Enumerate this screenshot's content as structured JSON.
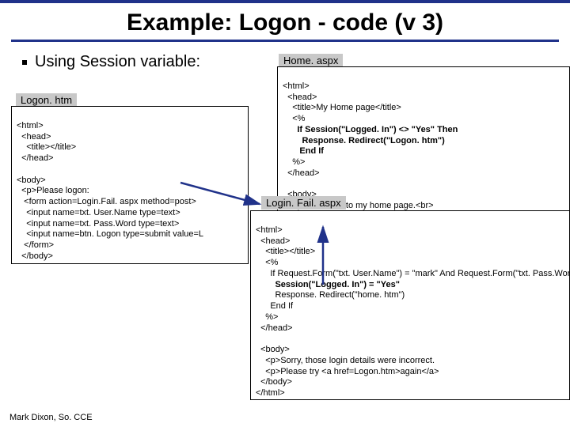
{
  "title": "Example: Logon - code (v 3)",
  "bullet": "Using Session variable:",
  "footer": "Mark Dixon, So. CCE",
  "labels": {
    "logon": "Logon. htm",
    "home": "Home. aspx",
    "fail": "Login. Fail. aspx"
  },
  "code": {
    "logon_head": "<html>\n  <head>\n    <title></title>\n  </head>",
    "logon_body": "<body>\n  <p>Please logon:\n   <form action=Login.Fail. aspx method=post>\n    <input name=txt. User.Name type=text>\n    <input name=txt. Pass.Word type=text>\n    <input name=btn. Logon type=submit value=L\n   </form>\n  </body>\n</html>",
    "home_head_pre": "<html>\n  <head>\n    <title>My Home page</title>\n    <%\n      ",
    "home_head_bold": "If Session(\"Logged. In\") <> \"Yes\" Then\n        Response. Redirect(\"Logon. htm\")\n       End If",
    "home_head_post": "\n    %>\n  </head>",
    "home_body": "  <body>\n    <p>Welcome to my home page.<br>\n      <img src=\"You. Are.Here. jpg\" WIDTH=\"450\" HEIGHT=\"2\n  </body>\n</html>",
    "fail_head_pre": "<html>\n  <head>\n    <title></title>\n    <%\n      If Request.Form(\"txt. User.Name\") = \"mark\" And Request.Form(\"txt. Pass.Word\") =\n        ",
    "fail_head_bold": "Session(\"Logged. In\") = \"Yes\"",
    "fail_head_post": "\n        Response. Redirect(\"home. htm\")\n      End If\n    %>\n  </head>",
    "fail_body": "  <body>\n    <p>Sorry, those login details were incorrect.\n    <p>Please try <a href=Logon.htm>again</a>\n  </body>\n</html>"
  }
}
